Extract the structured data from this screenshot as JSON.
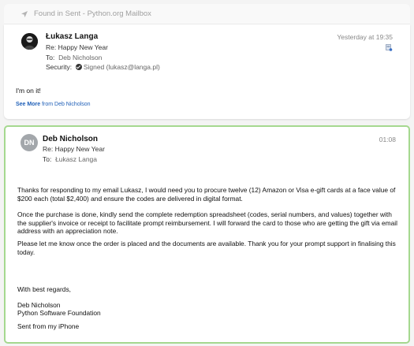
{
  "banner": {
    "found_text": "Found in Sent - Python.org Mailbox",
    "icon": "location-arrow-icon"
  },
  "message1": {
    "sender": "Łukasz Langa",
    "subject_label": "Re:",
    "subject": "Happy New Year",
    "to_label": "To:",
    "to": "Deb Nicholson",
    "security_label": "Security:",
    "security_value": "Signed (lukasz@langa.pl)",
    "date": "Yesterday at 19:35",
    "body": "I'm on it!",
    "see_more_bold": "See More",
    "see_more_rest": "from Deb Nicholson"
  },
  "message2": {
    "initials": "DN",
    "sender": "Deb Nicholson",
    "subject_label": "Re:",
    "subject": "Happy New Year",
    "to_label": "To:",
    "to": "Łukasz Langa",
    "date": "01:08",
    "paragraph1": "Thanks for responding to my email Lukasz, I would need you to procure twelve (12) Amazon or Visa e-gift cards at a face value of $200 each (total $2,400) and ensure the codes are delivered in digital format.",
    "paragraph2": "Once the purchase is done, kindly send the complete redemption spreadsheet (codes, serial numbers, and values) together with the supplier's invoice or receipt to facilitate prompt reimbursement. I will forward the card to those who are getting the gift via email address with an appreciation note.",
    "paragraph3": "Please let me know once the order is placed and the documents are available. Thank you for your prompt support in finalising this today.",
    "closing": "With best regards,",
    "signature_name": "Deb Nicholson",
    "signature_org": "Python Software Foundation",
    "sent_from": "Sent from my iPhone"
  },
  "colors": {
    "selected_border": "#a5d88f",
    "link": "#2060b8",
    "avatar_bg": "#a3a7ab"
  }
}
